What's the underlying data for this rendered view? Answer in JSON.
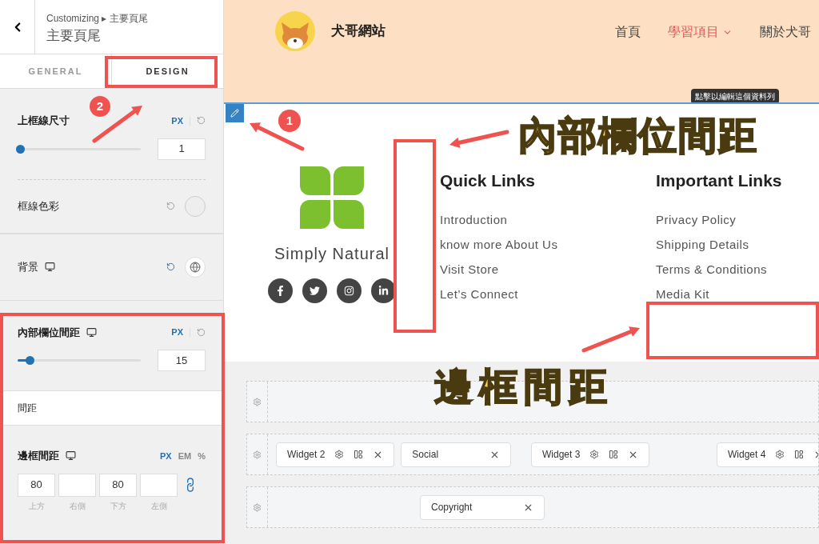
{
  "panel": {
    "breadcrumb": "Customizing ▸ 主要頁尾",
    "title": "主要頁尾",
    "tabs": [
      {
        "label": "GENERAL",
        "selected": false
      },
      {
        "label": "DESIGN",
        "selected": true
      }
    ],
    "controls": [
      {
        "kind": "slider",
        "label": "上框線尺寸",
        "device": false,
        "units": [
          {
            "label": "PX",
            "selected": true
          }
        ],
        "level": 0.0,
        "value": "1"
      },
      {
        "kind": "color",
        "label": "框線色彩"
      },
      {
        "kind": "background",
        "label": "背景",
        "device": true
      },
      {
        "kind": "slider",
        "label": "內部欄位間距",
        "device": true,
        "units": [
          {
            "label": "PX",
            "selected": true
          }
        ],
        "level": 0.08,
        "value": "15"
      },
      {
        "kind": "heading",
        "label": "間距"
      },
      {
        "kind": "spacing",
        "label": "邊框間距",
        "device": true,
        "units": [
          {
            "label": "PX",
            "selected": true
          },
          {
            "label": "EM",
            "selected": false
          },
          {
            "label": "%",
            "selected": false
          }
        ],
        "fields": [
          {
            "value": "80",
            "caption": "上方"
          },
          {
            "caption": "右側"
          },
          {
            "value": "80",
            "caption": "下方"
          },
          {
            "caption": "左側"
          }
        ]
      }
    ]
  },
  "site": {
    "name": "犬哥網站",
    "nav": [
      {
        "label": "首頁",
        "selected": false,
        "dropdown": false
      },
      {
        "label": "學習項目",
        "selected": true,
        "dropdown": true
      },
      {
        "label": "關於犬哥",
        "selected": false,
        "dropdown": false
      }
    ],
    "tooltip": "點擊以編輯這個資料列"
  },
  "footer": {
    "brand": "Simply Natural",
    "columns": [
      {
        "title": "Quick Links",
        "links": [
          "Introduction",
          "know more About Us",
          "Visit Store",
          "Let’s Connect"
        ]
      },
      {
        "title": "Important Links",
        "links": [
          "Privacy Policy",
          "Shipping Details",
          "Terms & Conditions",
          "Media Kit"
        ]
      }
    ]
  },
  "builder": {
    "rows": [
      {
        "items": []
      },
      {
        "items": [
          {
            "label": "Widget 2",
            "kind": "widget"
          },
          {
            "label": "Social",
            "kind": "simple"
          },
          {
            "label": "Widget 3",
            "kind": "widget"
          },
          {
            "label": "Widget 4",
            "kind": "widget"
          }
        ]
      },
      {
        "items": [
          {
            "label": "Copyright",
            "kind": "simple"
          }
        ]
      }
    ]
  },
  "annotations": {
    "badges": [
      "2",
      "1"
    ],
    "callouts": [
      "內部欄位間距",
      "邊框間距"
    ]
  }
}
